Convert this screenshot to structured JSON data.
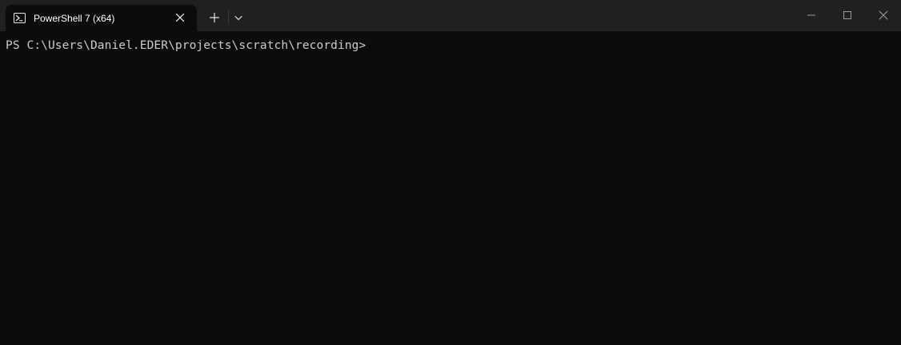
{
  "window": {
    "tab_title": "PowerShell 7 (x64)",
    "tab_icon": "powershell-icon",
    "new_tab_icon": "plus-icon",
    "dropdown_icon": "chevron-down-icon",
    "controls": [
      "minimize-icon",
      "maximize-icon",
      "close-icon"
    ]
  },
  "terminal": {
    "prompt": "PS C:\\Users\\Daniel.EDER\\projects\\scratch\\recording>"
  },
  "colors": {
    "titlebar_bg": "#202020",
    "terminal_bg": "#0c0c0c",
    "text": "#cccccc",
    "tab_text": "#ffffff"
  }
}
